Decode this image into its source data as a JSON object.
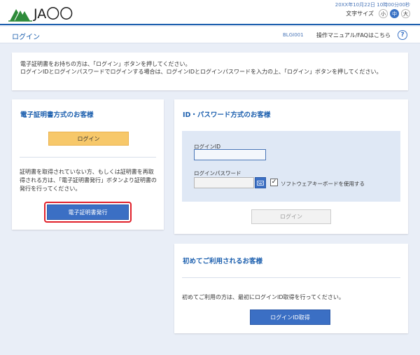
{
  "header": {
    "logo_text": "JA〇〇",
    "datetime": "20XX年10月22日 10時00分00秒",
    "font_size_label": "文字サイズ",
    "font_sizes": [
      "小",
      "中",
      "大"
    ],
    "font_size_selected": "中"
  },
  "titlebar": {
    "title": "ログイン",
    "screen_id": "BLGI001",
    "manual_link": "操作マニュアル/FAQはこちら",
    "help_symbol": "?"
  },
  "notice": {
    "line1": "電子証明書をお持ちの方は、「ログイン」ボタンを押してください。",
    "line2": "ログインIDとログインパスワードでログインする場合は、ログインIDとログインパスワードを入力の上、「ログイン」ボタンを押してください。"
  },
  "cert_section": {
    "title": "電子証明書方式のお客様",
    "login_button": "ログイン",
    "description": "証明書を取得されていない方、もしくは証明書を再取得される方は、「電子証明書発行」ボタンより証明書の発行を行ってください。",
    "issue_button": "電子証明書発行"
  },
  "id_section": {
    "title": "ID・パスワード方式のお客様",
    "login_id_label": "ログインID",
    "login_id_value": "",
    "password_label": "ログインパスワード",
    "password_value": "",
    "software_keyboard_label": "ソフトウェアキーボードを使用する",
    "software_keyboard_checked": true,
    "login_button": "ログイン"
  },
  "first_time_section": {
    "title": "初めてご利用されるお客様",
    "description": "初めてご利用の方は、最初にログインID取得を行ってください。",
    "get_id_button": "ログインID取得"
  },
  "colors": {
    "brand_blue": "#1c5fae",
    "button_blue": "#3b6fc4",
    "button_yellow": "#f7c86a",
    "highlight_red": "#e0202a",
    "background": "#e9eef7"
  },
  "icons": {
    "logo": "ja-logo-icon",
    "help": "question-circle-icon",
    "keyboard": "keyboard-icon",
    "check": "checkmark-icon"
  }
}
